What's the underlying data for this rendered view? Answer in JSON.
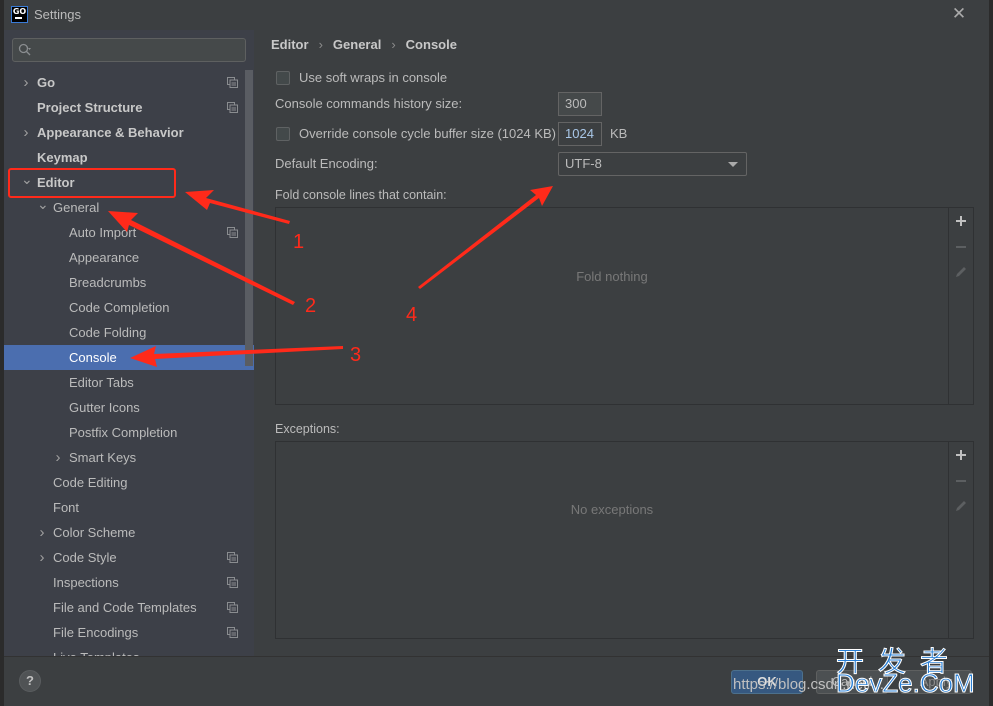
{
  "window": {
    "title": "Settings",
    "app_icon_text": "GO",
    "close_label": "✕"
  },
  "sidebar": {
    "search_placeholder": "",
    "items": [
      {
        "label": "Go",
        "level": 0,
        "bold": true,
        "expander": "collapsed",
        "copy_icon": true,
        "selected": false
      },
      {
        "label": "Project Structure",
        "level": 0,
        "bold": true,
        "expander": "none",
        "copy_icon": true,
        "selected": false
      },
      {
        "label": "Appearance & Behavior",
        "level": 0,
        "bold": true,
        "expander": "collapsed",
        "copy_icon": false,
        "selected": false
      },
      {
        "label": "Keymap",
        "level": 0,
        "bold": true,
        "expander": "none",
        "copy_icon": false,
        "selected": false
      },
      {
        "label": "Editor",
        "level": 0,
        "bold": true,
        "expander": "expanded",
        "copy_icon": false,
        "selected": false
      },
      {
        "label": "General",
        "level": 1,
        "bold": false,
        "expander": "expanded",
        "copy_icon": false,
        "selected": false
      },
      {
        "label": "Auto Import",
        "level": 2,
        "bold": false,
        "expander": "none",
        "copy_icon": true,
        "selected": false
      },
      {
        "label": "Appearance",
        "level": 2,
        "bold": false,
        "expander": "none",
        "copy_icon": false,
        "selected": false
      },
      {
        "label": "Breadcrumbs",
        "level": 2,
        "bold": false,
        "expander": "none",
        "copy_icon": false,
        "selected": false
      },
      {
        "label": "Code Completion",
        "level": 2,
        "bold": false,
        "expander": "none",
        "copy_icon": false,
        "selected": false
      },
      {
        "label": "Code Folding",
        "level": 2,
        "bold": false,
        "expander": "none",
        "copy_icon": false,
        "selected": false
      },
      {
        "label": "Console",
        "level": 2,
        "bold": false,
        "expander": "none",
        "copy_icon": false,
        "selected": true
      },
      {
        "label": "Editor Tabs",
        "level": 2,
        "bold": false,
        "expander": "none",
        "copy_icon": false,
        "selected": false
      },
      {
        "label": "Gutter Icons",
        "level": 2,
        "bold": false,
        "expander": "none",
        "copy_icon": false,
        "selected": false
      },
      {
        "label": "Postfix Completion",
        "level": 2,
        "bold": false,
        "expander": "none",
        "copy_icon": false,
        "selected": false
      },
      {
        "label": "Smart Keys",
        "level": 2,
        "bold": false,
        "expander": "collapsed",
        "copy_icon": false,
        "selected": false
      },
      {
        "label": "Code Editing",
        "level": 1,
        "bold": false,
        "expander": "none",
        "copy_icon": false,
        "selected": false
      },
      {
        "label": "Font",
        "level": 1,
        "bold": false,
        "expander": "none",
        "copy_icon": false,
        "selected": false
      },
      {
        "label": "Color Scheme",
        "level": 1,
        "bold": false,
        "expander": "collapsed",
        "copy_icon": false,
        "selected": false
      },
      {
        "label": "Code Style",
        "level": 1,
        "bold": false,
        "expander": "collapsed",
        "copy_icon": true,
        "selected": false
      },
      {
        "label": "Inspections",
        "level": 1,
        "bold": false,
        "expander": "none",
        "copy_icon": true,
        "selected": false
      },
      {
        "label": "File and Code Templates",
        "level": 1,
        "bold": false,
        "expander": "none",
        "copy_icon": true,
        "selected": false
      },
      {
        "label": "File Encodings",
        "level": 1,
        "bold": false,
        "expander": "none",
        "copy_icon": true,
        "selected": false
      },
      {
        "label": "Live Templates",
        "level": 1,
        "bold": false,
        "expander": "none",
        "copy_icon": false,
        "selected": false
      }
    ]
  },
  "breadcrumb": [
    "Editor",
    "General",
    "Console"
  ],
  "breadcrumb_separator": "›",
  "console": {
    "soft_wraps": {
      "label": "Use soft wraps in console",
      "checked": false
    },
    "history_size": {
      "label": "Console commands history size:",
      "value": "300"
    },
    "cycle_buffer": {
      "label": "Override console cycle buffer size (1024 KB)",
      "checked": false,
      "value": "1024",
      "unit": "KB"
    },
    "encoding": {
      "label": "Default Encoding:",
      "value": "UTF-8"
    },
    "fold_lines": {
      "label": "Fold console lines that contain:",
      "empty_text": "Fold nothing"
    },
    "exceptions": {
      "label": "Exceptions:",
      "empty_text": "No exceptions"
    }
  },
  "list_tools": {
    "add": "+",
    "remove": "−",
    "edit": "edit"
  },
  "footer": {
    "help_label": "?",
    "ok_label": "OK",
    "cancel_label": "Cancel",
    "apply_label": "Apply"
  },
  "annotations": {
    "color": "#ff2a1a",
    "labels": [
      "1",
      "2",
      "3",
      "4"
    ]
  },
  "watermark": {
    "url": "https://blog.csdn.net/...",
    "cn": "开发者",
    "en": "DevZe.CoM"
  }
}
